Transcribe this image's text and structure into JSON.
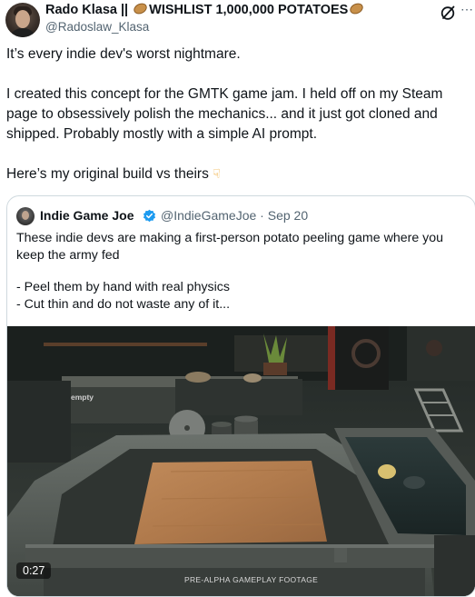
{
  "post": {
    "author_name": "Rado Klasa ||",
    "author_tag": "WISHLIST 1,000,000 POTATOES",
    "handle": "@Radoslaw_Klasa",
    "paragraph1": "It’s every indie dev's worst nightmare.",
    "paragraph2_line1": "I created this concept for the GMTK game jam. I held off on my Steam",
    "paragraph2_line2": "page to obsessively polish the mechanics... and it just got cloned and",
    "paragraph2_line3": "shipped. Probably mostly with a simple AI prompt.",
    "paragraph3": "Here’s my original build vs theirs",
    "icons": [
      "potato-emoji",
      "grok-icon",
      "more-icon",
      "pointing-down-emoji"
    ]
  },
  "quoted": {
    "name": "Indie Game Joe",
    "handle": "@IndieGameJoe",
    "separator": "·",
    "date": "Sep 20",
    "line1": "These indie devs are making a first-person potato peeling game where you",
    "line2": "keep the army fed",
    "line3": "- Peel them by hand with real physics",
    "line4": "- Cut thin and do not waste any of it...",
    "media": {
      "duration": "0:27",
      "overlay_label": "PRE-ALPHA GAMEPLAY FOOTAGE",
      "sign_label": "empty"
    }
  },
  "colors": {
    "text": "#0f1419",
    "secondary": "#536471",
    "verified": "#1d9bf0",
    "border": "#cfd9de"
  }
}
